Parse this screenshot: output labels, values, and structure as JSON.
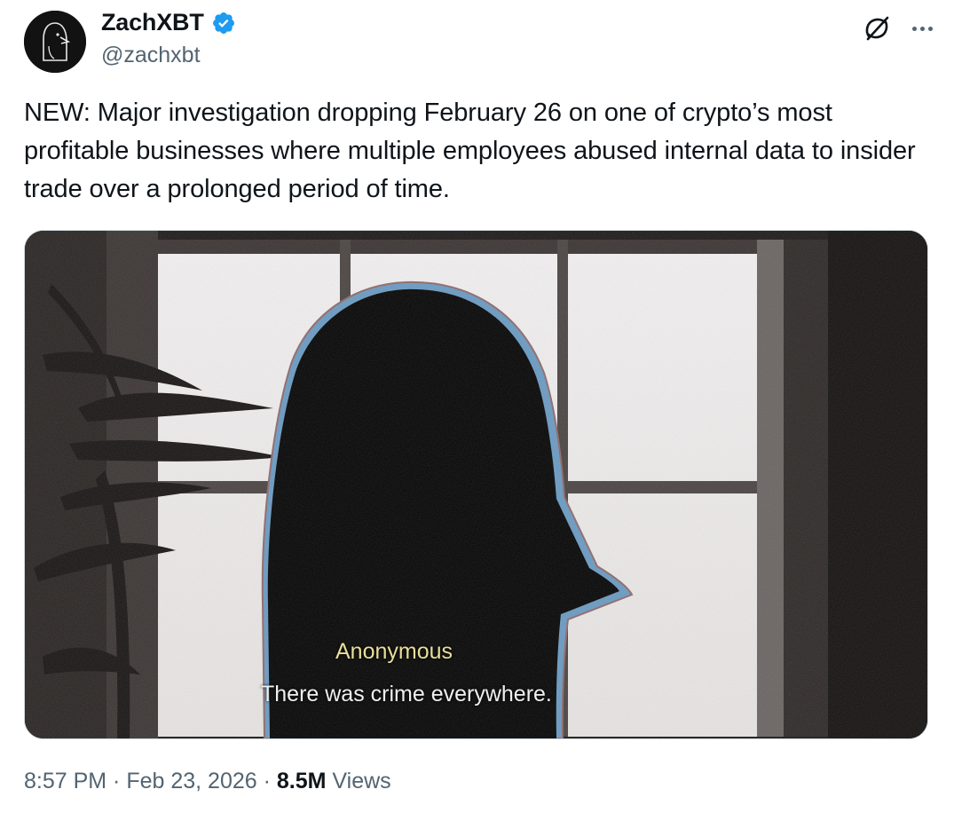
{
  "author": {
    "display_name": "ZachXBT",
    "handle": "@zachxbt",
    "verified": true,
    "avatar_icon": "penguin-avatar",
    "verified_color": "#1d9bf0"
  },
  "actions": {
    "grok_icon": "grok-icon",
    "more_icon": "more-icon"
  },
  "tweet": {
    "text": "NEW: Major investigation dropping February 26 on one of crypto’s most profitable businesses where multiple employees abused internal data to insider trade over a prolonged period of time."
  },
  "media": {
    "caption_name": "Anonymous",
    "caption_quote": "There was crime everywhere."
  },
  "meta": {
    "time": "8:57 PM",
    "separator": " · ",
    "date": "Feb 23, 2026",
    "views_count": "8.5M",
    "views_label": " Views"
  },
  "colors": {
    "text_primary": "#0f1419",
    "text_secondary": "#536471",
    "caption_name": "#e9df9a"
  }
}
